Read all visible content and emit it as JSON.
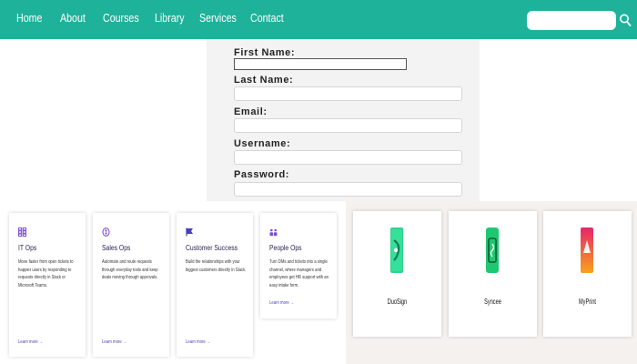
{
  "nav": {
    "links": [
      "Home",
      "About",
      "Courses",
      "Library",
      "Services",
      "Contact"
    ],
    "search_placeholder": "",
    "search_icon": "search-icon",
    "background_color": "#1fb29a"
  },
  "form": {
    "first_name_label": "First Name:",
    "last_name_label": "Last Name:",
    "email_label": "Email:",
    "username_label": "Username:",
    "password_label": "Password:",
    "first_name_value": "",
    "last_name_value": "",
    "email_value": "",
    "username_value": "",
    "password_value": ""
  },
  "cards": [
    {
      "icon": "grid-icon",
      "title": "IT Ops",
      "description": "Move faster from open tickets to happier users by responding to requests directly in Slack or Microsoft Teams.",
      "link": "Learn more →"
    },
    {
      "icon": "sales-icon",
      "title": "Sales Ops",
      "description": "Automate and route requests through everyday tools and keep deals moving through approvals.",
      "link": "Learn more →"
    },
    {
      "icon": "flag-icon",
      "title": "Customer Success",
      "description": "Build the relationships with your biggest customers directly in Slack.",
      "link": "Learn more →"
    },
    {
      "icon": "people-icon",
      "title": "People Ops",
      "description": "Turn DMs and tickets into a single channel, where managers and employees get HR support with an easy intake form.",
      "link": "Learn more →"
    }
  ],
  "apps": [
    {
      "name": "DuoSign",
      "icon_color": "#2fd38a"
    },
    {
      "name": "Syncee",
      "icon_color": "#1ec873"
    },
    {
      "name": "MyPrint",
      "icon_color": "#f05a28"
    }
  ]
}
